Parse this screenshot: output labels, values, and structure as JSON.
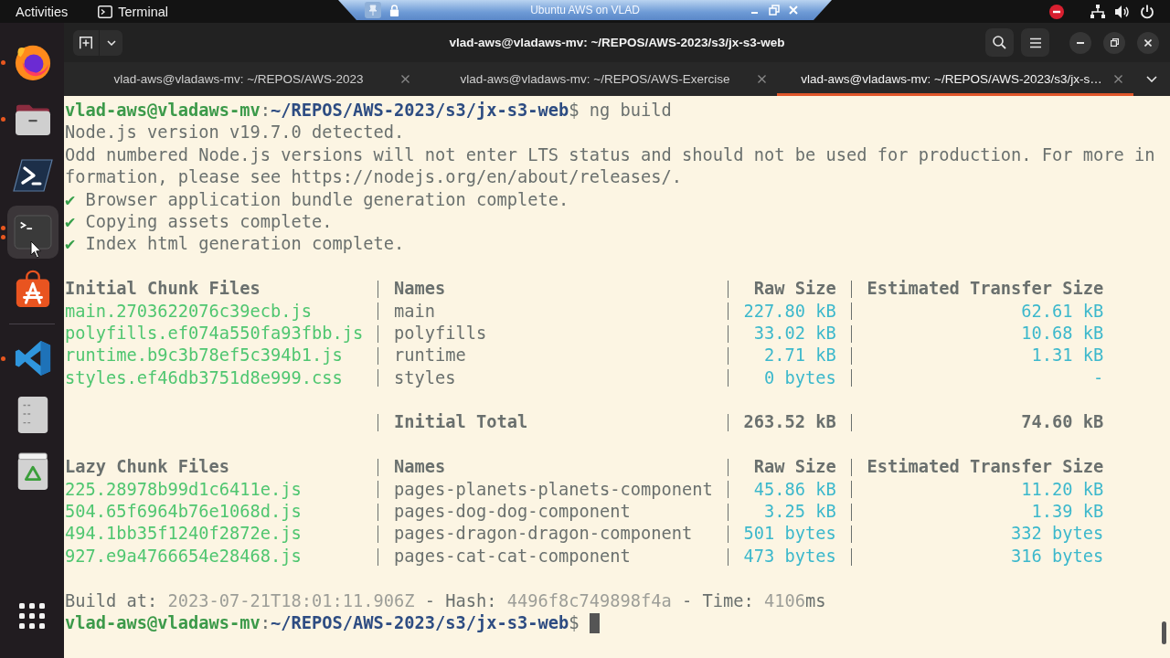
{
  "top_bar": {
    "activities": "Activities",
    "app_menu": "Terminal"
  },
  "vm_toolbar": {
    "title": "Ubuntu AWS on VLAD"
  },
  "dock": {
    "groups": [
      [
        {
          "kind": "browser",
          "running": true,
          "multiple_windows": false,
          "selected": false
        },
        {
          "kind": "files",
          "running": true,
          "multiple_windows": false,
          "selected": false
        },
        {
          "kind": "shell",
          "running": false,
          "multiple_windows": false,
          "selected": false
        },
        {
          "kind": "terminal",
          "running": true,
          "multiple_windows": true,
          "selected": true
        },
        {
          "kind": "store",
          "running": false,
          "multiple_windows": false,
          "selected": false
        }
      ],
      [
        {
          "kind": "code",
          "running": true,
          "multiple_windows": false,
          "selected": false
        },
        {
          "kind": "document",
          "running": false,
          "multiple_windows": false,
          "selected": false
        },
        {
          "kind": "trash",
          "running": false,
          "multiple_windows": false,
          "selected": false
        }
      ]
    ]
  },
  "terminal_window": {
    "title": "vlad-aws@vladaws-mv: ~/REPOS/AWS-2023/s3/jx-s3-web",
    "tabs": [
      {
        "label": "vlad-aws@vladaws-mv: ~/REPOS/AWS-2023",
        "selected": false
      },
      {
        "label": "vlad-aws@vladaws-mv: ~/REPOS/AWS-Exercise",
        "selected": false
      },
      {
        "label": "vlad-aws@vladaws-mv: ~/REPOS/AWS-2023/s3/jx-s…",
        "selected": true
      }
    ]
  },
  "terminal": {
    "command_prompt": {
      "user_host": "vlad-aws@vladaws-mv",
      "separator": ":",
      "path": "~/REPOS/AWS-2023/s3/jx-s3-web",
      "symbol": "$",
      "command": "ng build"
    },
    "messages": [
      "Node.js version v19.7.0 detected.",
      "Odd numbered Node.js versions will not enter LTS status and should not be used for production. For more in",
      "formation, please see https://nodejs.org/en/about/releases/."
    ],
    "steps": [
      {
        "mark": "✔",
        "text": "Browser application bundle generation complete."
      },
      {
        "mark": "✔",
        "text": "Copying assets complete."
      },
      {
        "mark": "✔",
        "text": "Index html generation complete."
      }
    ],
    "initial_chunks": {
      "columns": [
        "Initial Chunk Files",
        "Names",
        "Raw Size",
        "Estimated Transfer Size"
      ],
      "rows": [
        {
          "file": "main.2703622076c39ecb.js",
          "name": "main",
          "raw_size": "227.80 kB",
          "transfer_size": "62.61 kB"
        },
        {
          "file": "polyfills.ef074a550fa93fbb.js",
          "name": "polyfills",
          "raw_size": "33.02 kB",
          "transfer_size": "10.68 kB"
        },
        {
          "file": "runtime.b9c3b78ef5c394b1.js",
          "name": "runtime",
          "raw_size": "2.71 kB",
          "transfer_size": "1.31 kB"
        },
        {
          "file": "styles.ef46db3751d8e999.css",
          "name": "styles",
          "raw_size": "0 bytes",
          "transfer_size": "-"
        }
      ],
      "total": {
        "label": "Initial Total",
        "raw_size": "263.52 kB",
        "transfer_size": "74.60 kB"
      }
    },
    "lazy_chunks": {
      "columns": [
        "Lazy Chunk Files",
        "Names",
        "Raw Size",
        "Estimated Transfer Size"
      ],
      "rows": [
        {
          "file": "225.28978b99d1c6411e.js",
          "name": "pages-planets-planets-component",
          "raw_size": "45.86 kB",
          "transfer_size": "11.20 kB"
        },
        {
          "file": "504.65f6964b76e1068d.js",
          "name": "pages-dog-dog-component",
          "raw_size": "3.25 kB",
          "transfer_size": "1.39 kB"
        },
        {
          "file": "494.1bb35f1240f2872e.js",
          "name": "pages-dragon-dragon-component",
          "raw_size": "501 bytes",
          "transfer_size": "332 bytes"
        },
        {
          "file": "927.e9a4766654e28468.js",
          "name": "pages-cat-cat-component",
          "raw_size": "473 bytes",
          "transfer_size": "316 bytes"
        }
      ]
    },
    "build_summary": [
      {
        "kind": "label",
        "text": "Build at:"
      },
      {
        "kind": "value",
        "text": "2023-07-21T18:01:11.906Z"
      },
      {
        "kind": "label",
        "text": "- Hash:"
      },
      {
        "kind": "value",
        "text": "4496f8c749898f4a"
      },
      {
        "kind": "label",
        "text": "- Time:"
      },
      {
        "kind": "value",
        "text": "4106"
      },
      {
        "kind": "unit",
        "text": "ms"
      }
    ],
    "final_prompt": {
      "user_host": "vlad-aws@vladaws-mv",
      "separator": ":",
      "path": "~/REPOS/AWS-2023/s3/jx-s3-web",
      "symbol": "$",
      "cursor": true
    }
  }
}
